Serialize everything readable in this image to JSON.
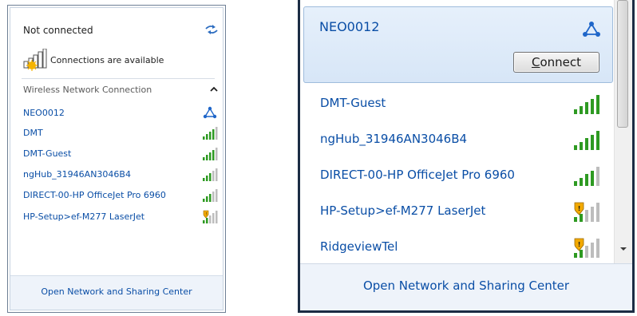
{
  "left_panel": {
    "status": "Not connected",
    "connections_text": "Connections are available",
    "section_title": "Wireless Network Connection",
    "networks": [
      {
        "name": "NEO0012",
        "icon": "network-connect-icon"
      },
      {
        "name": "DMT",
        "icon": "signal-bars-icon"
      },
      {
        "name": "DMT-Guest",
        "icon": "signal-bars-icon"
      },
      {
        "name": "ngHub_31946AN3046B4",
        "icon": "signal-bars-icon"
      },
      {
        "name": "DIRECT-00-HP OfficeJet Pro 6960",
        "icon": "signal-bars-icon"
      },
      {
        "name": "HP-Setup>ef-M277 LaserJet",
        "icon": "secured-signal-icon"
      }
    ],
    "footer_link": "Open Network and Sharing Center"
  },
  "right_panel": {
    "selected_network": {
      "name": "NEO0012",
      "icon": "network-connect-icon"
    },
    "connect_button": {
      "accesskey": "C",
      "rest": "onnect"
    },
    "networks": [
      {
        "name": "DMT-Guest",
        "icon": "signal-bars-icon"
      },
      {
        "name": "ngHub_31946AN3046B4",
        "icon": "signal-bars-icon"
      },
      {
        "name": "DIRECT-00-HP OfficeJet Pro 6960",
        "icon": "signal-bars-icon"
      },
      {
        "name": "HP-Setup>ef-M277 LaserJet",
        "icon": "secured-signal-icon"
      },
      {
        "name": "RidgeviewTel",
        "icon": "secured-signal-icon"
      }
    ],
    "footer_link": "Open Network and Sharing Center"
  },
  "colors": {
    "link_blue": "#0a4ea6",
    "signal_green": "#2e9a22",
    "selection_bg": "#dce9f7",
    "footer_bg": "#eef3fa"
  }
}
